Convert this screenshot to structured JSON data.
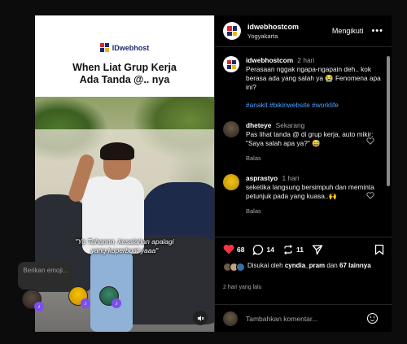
{
  "media": {
    "brand_name": "IDwebhost",
    "headline_line1": "When Liat Grup Kerja",
    "headline_line2": "Ada Tanda @.. nya",
    "caption_line1": "\"Ya Tuhannn, kesalahan apalagi",
    "caption_line2": "yang kuperbuat yaaa\"",
    "audio_icon": "speaker-muted-icon"
  },
  "reaction_overlay": {
    "prompt": "Berikan emoji...",
    "badge_glyph": "♪"
  },
  "header": {
    "username": "idwebhostcom",
    "location": "Yogyakarta",
    "follow_label": "Mengikuti",
    "more_label": "•••"
  },
  "caption_post": {
    "username": "idwebhostcom",
    "time": "2 hari",
    "text": "Perasaan nggak ngapa-ngapain deh.. kok berasa ada yang salah ya 😭 Fenomena apa ini?",
    "tags": "#anakit #bikinwebsite #worklife"
  },
  "comments": [
    {
      "username": "dheteye",
      "time": "Sekarang",
      "text": "Pas lihat tanda @ di grup kerja, auto mikir: \"Saya salah apa ya?\" 😅",
      "reply_label": "Balas"
    },
    {
      "username": "asprastyo",
      "time": "1 hari",
      "text": "seketika langsung bersimpuh dan meminta petunjuk pada yang kuasa..🙌",
      "reply_label": "Balas"
    }
  ],
  "actions": {
    "like_count": "68",
    "comment_count": "14",
    "share_count": "11"
  },
  "likes": {
    "prefix": "Disukai oleh",
    "first_user": "cyndia_pram",
    "middle": "dan",
    "others": "67 lainnya"
  },
  "post_date": "2 hari yang lalu",
  "add_comment": {
    "placeholder": "Tambahkan komentar..."
  },
  "colors": {
    "like_red": "#ff3040",
    "link_blue": "#4ea0ff",
    "brand_navy": "#1a2a6c",
    "brand_red": "#e0262b",
    "brand_yellow": "#f6b400",
    "reaction_purple": "#7b4ff0"
  }
}
